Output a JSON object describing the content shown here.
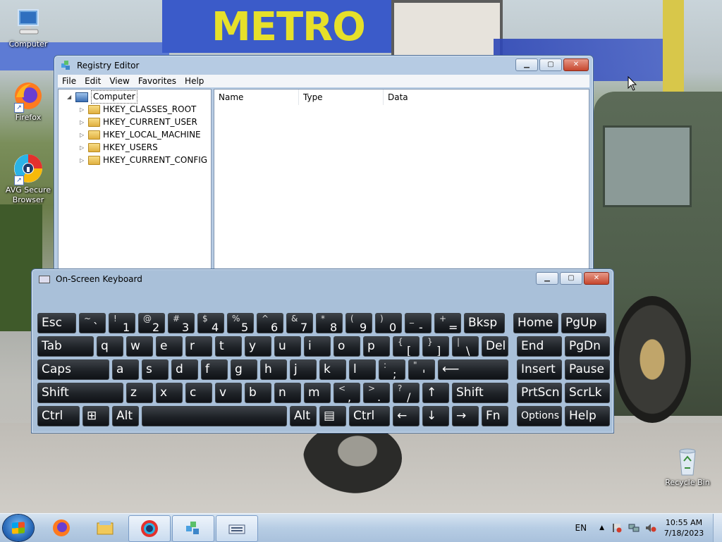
{
  "desktop": {
    "wallpaper_text": "METRO",
    "icons": [
      {
        "label": "Computer"
      },
      {
        "label": "Firefox"
      },
      {
        "label": "AVG Secure Browser"
      },
      {
        "label": "Recycle Bin"
      }
    ]
  },
  "regedit": {
    "title": "Registry Editor",
    "menu": [
      "File",
      "Edit",
      "View",
      "Favorites",
      "Help"
    ],
    "tree": {
      "root": "Computer",
      "children": [
        "HKEY_CLASSES_ROOT",
        "HKEY_CURRENT_USER",
        "HKEY_LOCAL_MACHINE",
        "HKEY_USERS",
        "HKEY_CURRENT_CONFIG"
      ]
    },
    "columns": [
      "Name",
      "Type",
      "Data"
    ]
  },
  "osk": {
    "title": "On-Screen Keyboard",
    "rows": [
      [
        {
          "main": "Esc"
        },
        {
          "top": "~",
          "bot": "`"
        },
        {
          "top": "!",
          "bot": "1"
        },
        {
          "top": "@",
          "bot": "2"
        },
        {
          "top": "#",
          "bot": "3"
        },
        {
          "top": "$",
          "bot": "4"
        },
        {
          "top": "%",
          "bot": "5"
        },
        {
          "top": "^",
          "bot": "6"
        },
        {
          "top": "&",
          "bot": "7"
        },
        {
          "top": "*",
          "bot": "8"
        },
        {
          "top": "(",
          "bot": "9"
        },
        {
          "top": ")",
          "bot": "0"
        },
        {
          "top": "_",
          "bot": "-"
        },
        {
          "top": "+",
          "bot": "="
        },
        {
          "main": "Bksp"
        },
        {
          "main": "Home"
        },
        {
          "main": "PgUp"
        }
      ],
      [
        {
          "main": "Tab"
        },
        {
          "main": "q"
        },
        {
          "main": "w"
        },
        {
          "main": "e"
        },
        {
          "main": "r"
        },
        {
          "main": "t"
        },
        {
          "main": "y"
        },
        {
          "main": "u"
        },
        {
          "main": "i"
        },
        {
          "main": "o"
        },
        {
          "main": "p"
        },
        {
          "top": "{",
          "bot": "["
        },
        {
          "top": "}",
          "bot": "]"
        },
        {
          "top": "|",
          "bot": "\\"
        },
        {
          "main": "Del"
        },
        {
          "main": "End"
        },
        {
          "main": "PgDn"
        }
      ],
      [
        {
          "main": "Caps"
        },
        {
          "main": "a"
        },
        {
          "main": "s"
        },
        {
          "main": "d"
        },
        {
          "main": "f"
        },
        {
          "main": "g"
        },
        {
          "main": "h"
        },
        {
          "main": "j"
        },
        {
          "main": "k"
        },
        {
          "main": "l"
        },
        {
          "top": ":",
          "bot": ";"
        },
        {
          "top": "\"",
          "bot": "'"
        },
        {
          "main": "⟵"
        },
        {
          "main": "Insert"
        },
        {
          "main": "Pause"
        }
      ],
      [
        {
          "main": "Shift"
        },
        {
          "main": "z"
        },
        {
          "main": "x"
        },
        {
          "main": "c"
        },
        {
          "main": "v"
        },
        {
          "main": "b"
        },
        {
          "main": "n"
        },
        {
          "main": "m"
        },
        {
          "top": "<",
          "bot": ","
        },
        {
          "top": ">",
          "bot": "."
        },
        {
          "top": "?",
          "bot": "/"
        },
        {
          "main": "↑"
        },
        {
          "main": "Shift"
        },
        {
          "main": "PrtScn"
        },
        {
          "main": "ScrLk"
        }
      ],
      [
        {
          "main": "Ctrl"
        },
        {
          "main": "⊞"
        },
        {
          "main": "Alt"
        },
        {
          "main": ""
        },
        {
          "main": "Alt"
        },
        {
          "main": "▤"
        },
        {
          "main": "Ctrl"
        },
        {
          "main": "←"
        },
        {
          "main": "↓"
        },
        {
          "main": "→"
        },
        {
          "main": "Fn"
        },
        {
          "main": "Options"
        },
        {
          "main": "Help"
        }
      ]
    ]
  },
  "taskbar": {
    "language": "EN",
    "time": "10:55 AM",
    "date": "7/18/2023",
    "apps": [
      "firefox",
      "file-explorer",
      "avg-secure-browser",
      "registry-editor",
      "on-screen-keyboard"
    ]
  }
}
